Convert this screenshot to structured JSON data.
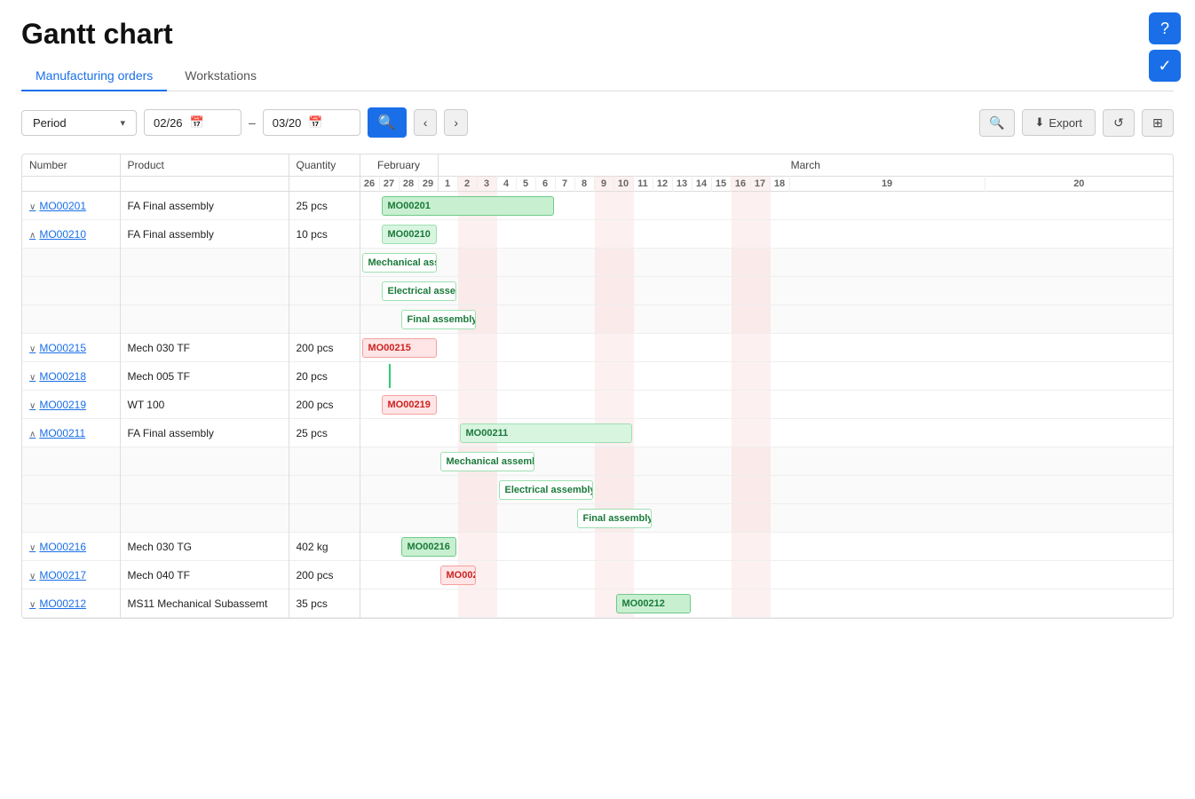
{
  "page": {
    "title": "Gantt chart",
    "tabs": [
      {
        "id": "manufacturing",
        "label": "Manufacturing orders",
        "active": true
      },
      {
        "id": "workstations",
        "label": "Workstations",
        "active": false
      }
    ]
  },
  "toolbar": {
    "period_label": "Period",
    "date_from": "02/26",
    "date_to": "03/20",
    "export_label": "Export"
  },
  "gantt": {
    "columns": {
      "number": "Number",
      "product": "Product",
      "quantity": "Quantity"
    },
    "months": [
      {
        "label": "February",
        "days": [
          "26",
          "27",
          "28",
          "29"
        ]
      },
      {
        "label": "March",
        "days": [
          "1",
          "2",
          "3",
          "4",
          "5",
          "6",
          "7",
          "8",
          "9",
          "10",
          "11",
          "12",
          "13",
          "14",
          "15",
          "16",
          "17",
          "18",
          "19",
          "20"
        ]
      }
    ],
    "rows": [
      {
        "id": "MO00201",
        "number": "MO00201",
        "product": "FA Final assembly",
        "quantity": "25 pcs",
        "expand": "collapse",
        "bar": {
          "label": "MO00201",
          "type": "green",
          "start": 1,
          "width": 9
        },
        "children": []
      },
      {
        "id": "MO00210",
        "number": "MO00210",
        "product": "FA Final assembly",
        "quantity": "10 pcs",
        "expand": "expand",
        "bar": {
          "label": "MO00210",
          "type": "plain",
          "start": 1,
          "width": 3
        },
        "children": [
          {
            "label": "Mechanical assembly",
            "type": "outline",
            "start": 0,
            "width": 4
          },
          {
            "label": "Electrical assembly",
            "type": "outline",
            "start": 1,
            "width": 4
          },
          {
            "label": "Final assembly",
            "type": "outline",
            "start": 2,
            "width": 4
          }
        ]
      },
      {
        "id": "MO00215",
        "number": "MO00215",
        "product": "Mech 030 TF",
        "quantity": "200 pcs",
        "expand": "collapse",
        "bar": {
          "label": "MO00215",
          "type": "red-text",
          "start": 0,
          "width": 4
        },
        "children": []
      },
      {
        "id": "MO00218",
        "number": "MO00218",
        "product": "Mech 005 TF",
        "quantity": "20 pcs",
        "expand": "collapse",
        "bar": {
          "label": "",
          "type": "vline",
          "start": 1,
          "width": 0
        },
        "children": []
      },
      {
        "id": "MO00219",
        "number": "MO00219",
        "product": "WT 100",
        "quantity": "200 pcs",
        "expand": "collapse",
        "bar": {
          "label": "MO00219",
          "type": "red-text",
          "start": 1,
          "width": 3
        },
        "children": []
      },
      {
        "id": "MO00211",
        "number": "MO00211",
        "product": "FA Final assembly",
        "quantity": "25 pcs",
        "expand": "expand",
        "bar": {
          "label": "MO00211",
          "type": "plain",
          "start": 5,
          "width": 9
        },
        "children": [
          {
            "label": "Mechanical assembly",
            "type": "outline",
            "start": 4,
            "width": 5
          },
          {
            "label": "Electrical assembly",
            "type": "outline",
            "start": 7,
            "width": 5
          },
          {
            "label": "Final assembly",
            "type": "outline",
            "start": 11,
            "width": 4
          }
        ]
      },
      {
        "id": "MO00216",
        "number": "MO00216",
        "product": "Mech 030 TG",
        "quantity": "402 kg",
        "expand": "collapse",
        "bar": {
          "label": "MO00216",
          "type": "green",
          "start": 2,
          "width": 3
        },
        "children": []
      },
      {
        "id": "MO00217",
        "number": "MO00217",
        "product": "Mech 040 TF",
        "quantity": "200 pcs",
        "expand": "collapse",
        "bar": {
          "label": "MO002",
          "type": "red-text",
          "start": 4,
          "width": 2
        },
        "children": []
      },
      {
        "id": "MO00212",
        "number": "MO00212",
        "product": "MS11 Mechanical Subassemt",
        "quantity": "35 pcs",
        "expand": "collapse",
        "bar": {
          "label": "MO00212",
          "type": "green",
          "start": 13,
          "width": 4
        },
        "children": []
      }
    ]
  },
  "icons": {
    "help": "?",
    "check": "✓",
    "chevron_down": "▾",
    "calendar": "📅",
    "search": "🔍",
    "prev": "‹",
    "next": "›",
    "download": "⬇",
    "refresh": "↺",
    "grid": "⊞",
    "expand": "∨",
    "collapse": "∧"
  }
}
